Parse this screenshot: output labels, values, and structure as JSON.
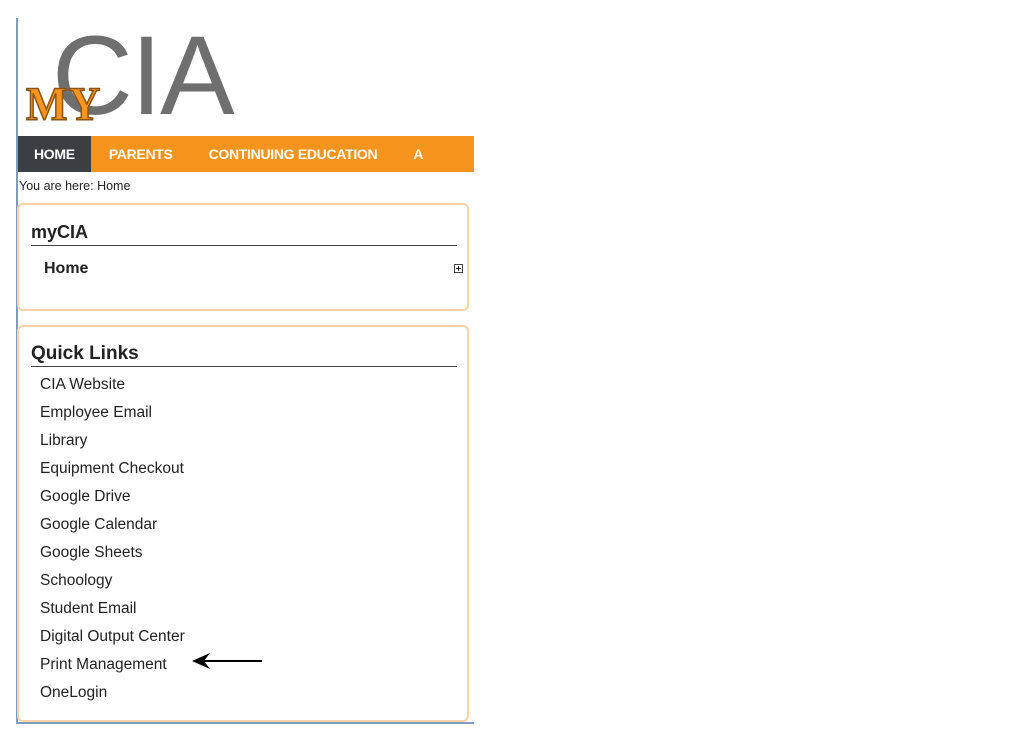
{
  "logo": {
    "my": "MY",
    "cia": "CIA"
  },
  "nav": {
    "items": [
      {
        "label": "HOME",
        "active": true
      },
      {
        "label": "PARENTS",
        "active": false
      },
      {
        "label": "CONTINUING EDUCATION",
        "active": false
      },
      {
        "label": "A",
        "active": false
      }
    ]
  },
  "breadcrumb": {
    "text": "You are here:  Home"
  },
  "mycia": {
    "title": "myCIA",
    "home_label": "Home"
  },
  "quick_links": {
    "title": "Quick Links",
    "items": [
      "CIA Website",
      "Employee Email",
      "Library",
      "Equipment Checkout",
      "Google Drive",
      "Google Calendar",
      "Google Sheets",
      "Schoology",
      "Student Email",
      "Digital Output Center",
      "Print Management",
      "OneLogin"
    ]
  },
  "colors": {
    "accent": "#f7941d",
    "nav_active": "#3b3f44",
    "portlet_border": "#fbd3a4"
  },
  "icons": {
    "expand": "plus-box-icon",
    "annotation": "arrow-left-icon"
  }
}
